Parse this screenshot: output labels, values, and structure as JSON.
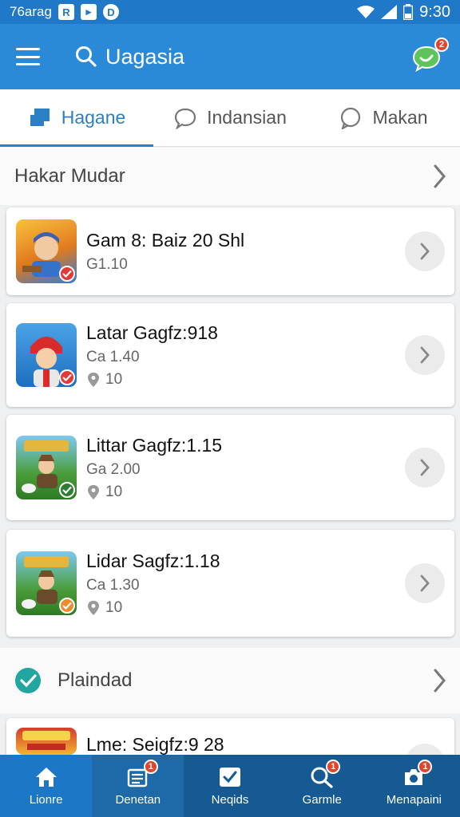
{
  "status_bar": {
    "carrier": "76arag",
    "time": "9:30",
    "chip_icons": [
      "R",
      "▸",
      "D"
    ]
  },
  "app_bar": {
    "search_text": "Uagasia",
    "chat_badge": "2"
  },
  "tabs": [
    {
      "label": "Hagane",
      "icon": "tag-icon",
      "active": true
    },
    {
      "label": "Indansian",
      "icon": "chat-bubble-icon",
      "active": false
    },
    {
      "label": "Makan",
      "icon": "message-icon",
      "active": false
    }
  ],
  "sections": [
    {
      "title": "Hakar Mudar"
    },
    {
      "title": "Plaindad"
    }
  ],
  "cards": [
    {
      "title": "Gam 8: Baiz 20 Shl",
      "subtitle": "G1.10",
      "meta": "",
      "badge_color": "#e53935"
    },
    {
      "title": "Latar Gagfz:918",
      "subtitle": "Ca 1.40",
      "meta": "10",
      "badge_color": "#e53935"
    },
    {
      "title": "Littar Gagfz:1.15",
      "subtitle": "Ga 2.00",
      "meta": "10",
      "badge_color": "#2e7d32"
    },
    {
      "title": "Lidar Sagfz:1.18",
      "subtitle": "Ca 1.30",
      "meta": "10",
      "badge_color": "#ef8a2c"
    },
    {
      "title": "Lme: Seigfz:9 28"
    }
  ],
  "bottom_nav": [
    {
      "label": "Lionre",
      "icon": "home-icon",
      "badge": ""
    },
    {
      "label": "Denetan",
      "icon": "list-icon",
      "badge": "1"
    },
    {
      "label": "Neqids",
      "icon": "checkbox-icon",
      "badge": ""
    },
    {
      "label": "Garmle",
      "icon": "search-icon",
      "badge": "1"
    },
    {
      "label": "Menapaini",
      "icon": "camera-icon",
      "badge": "1"
    }
  ],
  "colors": {
    "primary": "#2b8ad8",
    "status": "#1f78c8",
    "nav": "#155a93",
    "nav_active": "#1c78c6"
  }
}
